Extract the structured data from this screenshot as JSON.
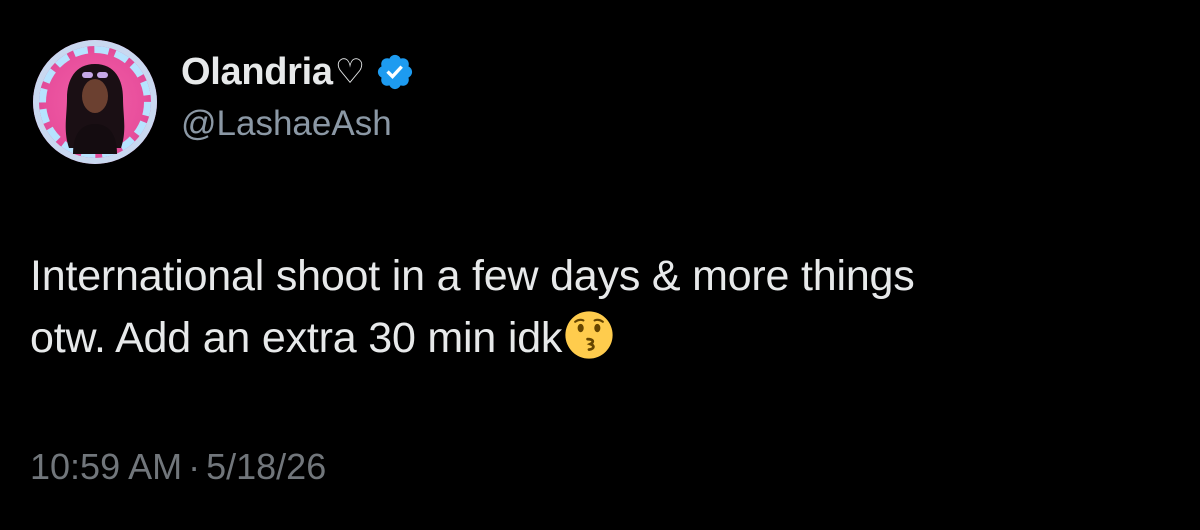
{
  "author": {
    "display_name": "Olandria",
    "name_symbol": "♡",
    "handle": "@LashaeAsh",
    "verified": true,
    "verified_color": "#1d9bf0"
  },
  "tweet": {
    "line1": "International shoot in a few days & more things",
    "line2": "otw. Add an extra 30 min idk",
    "emoji": "kissing-face-emoji"
  },
  "meta": {
    "time": "10:59 AM",
    "separator": "·",
    "date": "5/18/26"
  },
  "colors": {
    "background": "#000000",
    "text": "#e7e9ea",
    "secondary": "#71767b",
    "accent": "#1d9bf0"
  }
}
